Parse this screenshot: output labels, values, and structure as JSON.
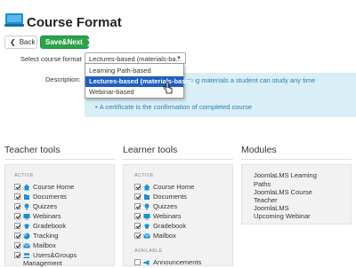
{
  "page": {
    "title": "Course Format"
  },
  "toolbar": {
    "back_label": "Back",
    "save_next_label": "Save&Next"
  },
  "form": {
    "select_label": "Select course format",
    "selected_value": "Lectures-based (materials-ba...",
    "description_label": "Description:",
    "description_fragment": "ning materials a student can study any time",
    "description_bullet": "A certificate is the confirmation of completed course"
  },
  "dropdown": {
    "options": [
      "Learning Path-based",
      "Lectures-based (materials-based)",
      "Webinar-based"
    ],
    "highlighted_index": 1
  },
  "teacher_tools": {
    "title": "Teacher tools",
    "group_label": "ACTIVE",
    "items": [
      "Course Home",
      "Documents",
      "Quizzes",
      "Webinars",
      "Gradebook",
      "Tracking",
      "Mailbox",
      "Users&Groups",
      "Management"
    ]
  },
  "learner_tools": {
    "title": "Learner tools",
    "active_label": "ACTIVE",
    "active_items": [
      "Course Home",
      "Documents",
      "Quizzes",
      "Webinars",
      "Gradebook",
      "Mailbox"
    ],
    "available_label": "AVAILABLE",
    "available_items": [
      "Announcements"
    ]
  },
  "modules": {
    "title": "Modules",
    "items": [
      "JoomlaLMS Learning",
      "Paths",
      "JoomlaLMS Course",
      "Teacher",
      "JoomlaLMS",
      "Upcoming Webinar"
    ]
  },
  "colors": {
    "accent_blue": "#1e8fd0",
    "save_green": "#2ca24b",
    "highlight": "#1e5fc2",
    "info_bg": "#d9eef6"
  }
}
